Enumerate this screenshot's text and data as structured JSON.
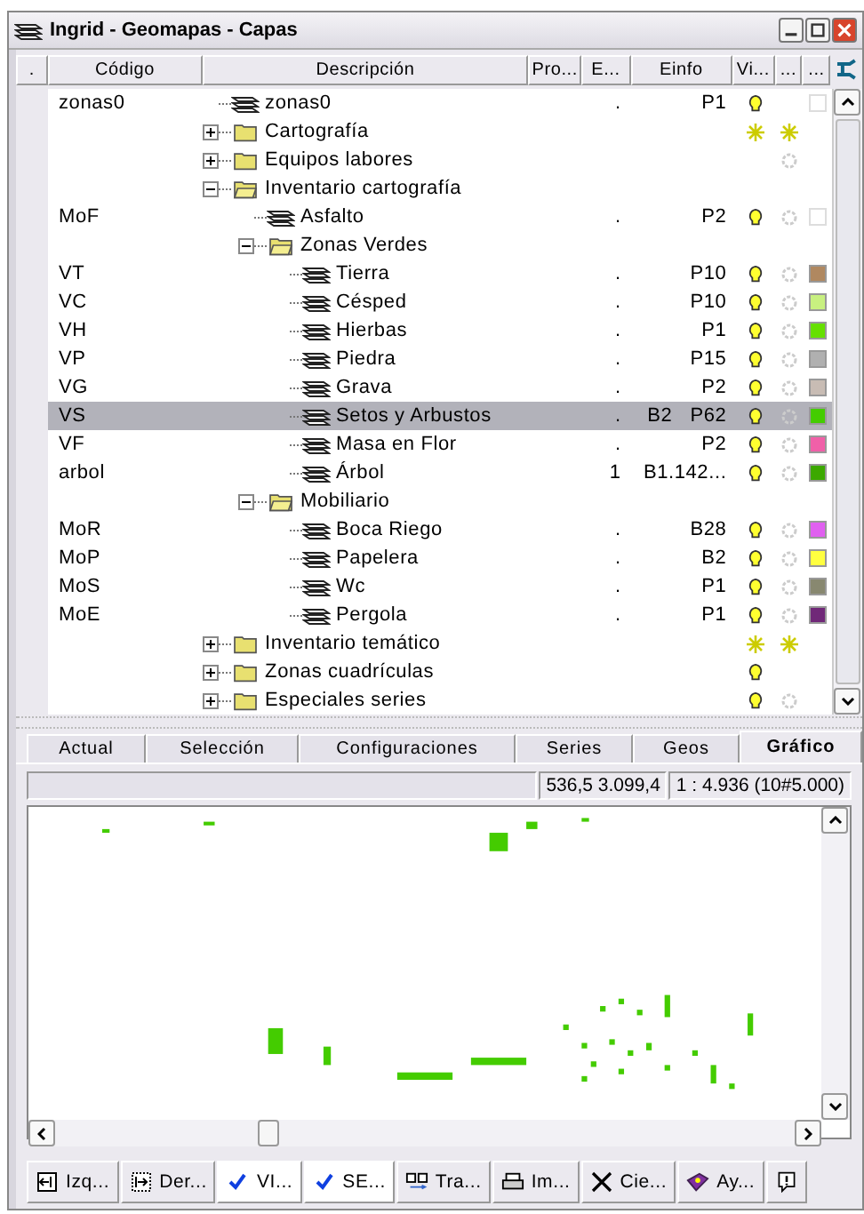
{
  "window": {
    "title": "Ingrid - Geomapas - Capas"
  },
  "table": {
    "columns": [
      ".",
      "Código",
      "Descripción",
      "Pro...",
      "E...",
      "Einfo",
      "Vi...",
      "...",
      "..."
    ],
    "rows": [
      {
        "kind": "layer",
        "code": "zonas0",
        "name": "zonas0",
        "mark": ".",
        "einfo": "P1",
        "visible": true,
        "partial": false,
        "ring": false,
        "checked": false,
        "selected": false
      },
      {
        "kind": "folder",
        "name": "Cartografía",
        "expanded": false,
        "visible": false,
        "partial": true,
        "ring": false,
        "selected": false
      },
      {
        "kind": "folder",
        "name": "Equipos labores",
        "expanded": false,
        "visible": false,
        "partial": false,
        "ring": true,
        "selected": false
      },
      {
        "kind": "folder",
        "name": "Inventario cartografía",
        "expanded": true,
        "visible": false,
        "partial": false,
        "ring": false,
        "selected": false,
        "children": [
          {
            "kind": "layer",
            "code": "MoF",
            "name": "Asfalto",
            "mark": ".",
            "einfo": "P2",
            "visible": true,
            "partial": false,
            "ring": true,
            "checked": false,
            "selected": false
          },
          {
            "kind": "folder",
            "name": "Zonas Verdes",
            "expanded": true,
            "visible": false,
            "partial": false,
            "ring": false,
            "selected": false,
            "children": [
              {
                "kind": "layer",
                "code": "VT",
                "name": "Tierra",
                "mark": ".",
                "einfo": "P10",
                "visible": true,
                "partial": false,
                "ring": true,
                "color": "#b08860",
                "selected": false
              },
              {
                "kind": "layer",
                "code": "VC",
                "name": "Césped",
                "mark": ".",
                "einfo": "P10",
                "visible": true,
                "partial": false,
                "ring": true,
                "color": "#c8f080",
                "selected": false
              },
              {
                "kind": "layer",
                "code": "VH",
                "name": "Hierbas",
                "mark": ".",
                "einfo": "P1",
                "visible": true,
                "partial": false,
                "ring": true,
                "color": "#66e000",
                "selected": false
              },
              {
                "kind": "layer",
                "code": "VP",
                "name": "Piedra",
                "mark": ".",
                "einfo": "P15",
                "visible": true,
                "partial": false,
                "ring": true,
                "color": "#b0b0b0",
                "selected": false
              },
              {
                "kind": "layer",
                "code": "VG",
                "name": "Grava",
                "mark": ".",
                "einfo": "P2",
                "visible": true,
                "partial": false,
                "ring": true,
                "color": "#c8bcb4",
                "selected": false
              },
              {
                "kind": "layer",
                "code": "VS",
                "name": "Setos y Arbustos",
                "mark": ".",
                "extra": "B2",
                "einfo": "P62",
                "visible": true,
                "partial": false,
                "ring": true,
                "color": "#44cc00",
                "selected": true
              },
              {
                "kind": "layer",
                "code": "VF",
                "name": "Masa en Flor",
                "mark": ".",
                "einfo": "P2",
                "visible": true,
                "partial": false,
                "ring": true,
                "color": "#f060a8",
                "selected": false
              },
              {
                "kind": "layer",
                "code": "arbol",
                "name": "Árbol",
                "mark": "1",
                "einfo": "B1.142...",
                "visible": true,
                "partial": false,
                "ring": true,
                "color": "#3ca800",
                "selected": false
              }
            ]
          },
          {
            "kind": "folder",
            "name": "Mobiliario",
            "expanded": true,
            "visible": false,
            "partial": false,
            "ring": false,
            "selected": false,
            "children": [
              {
                "kind": "layer",
                "code": "MoR",
                "name": "Boca Riego",
                "mark": ".",
                "einfo": "B28",
                "visible": true,
                "partial": false,
                "ring": true,
                "color": "#e060f0",
                "selected": false
              },
              {
                "kind": "layer",
                "code": "MoP",
                "name": "Papelera",
                "mark": ".",
                "einfo": "B2",
                "visible": true,
                "partial": false,
                "ring": true,
                "color": "#ffff40",
                "selected": false
              },
              {
                "kind": "layer",
                "code": "MoS",
                "name": "Wc",
                "mark": ".",
                "einfo": "P1",
                "visible": true,
                "partial": false,
                "ring": true,
                "color": "#888870",
                "selected": false
              },
              {
                "kind": "layer",
                "code": "MoE",
                "name": "Pergola",
                "mark": ".",
                "einfo": "P1",
                "visible": true,
                "partial": false,
                "ring": true,
                "color": "#702878",
                "selected": false
              }
            ]
          }
        ]
      },
      {
        "kind": "folder",
        "name": "Inventario temático",
        "expanded": false,
        "visible": false,
        "partial": true,
        "ring": false,
        "selected": false
      },
      {
        "kind": "folder",
        "name": "Zonas cuadrículas",
        "expanded": false,
        "visible": true,
        "partial": false,
        "ring": false,
        "selected": false
      },
      {
        "kind": "folder",
        "name": "Especiales series",
        "expanded": false,
        "visible": true,
        "partial": false,
        "ring": true,
        "selected": false
      }
    ]
  },
  "tabs": [
    {
      "label": "Actual",
      "selected": false
    },
    {
      "label": "Selección",
      "selected": false
    },
    {
      "label": "Configuraciones",
      "selected": false
    },
    {
      "label": "Series",
      "selected": false
    },
    {
      "label": "Geos",
      "selected": false
    },
    {
      "label": "Gráfico",
      "selected": true
    }
  ],
  "status": {
    "coords": "536,5  3.099,4",
    "scale": "1 : 4.936 (10#5.000)"
  },
  "toolbar": [
    {
      "kind": "left",
      "label": "Izq..."
    },
    {
      "kind": "right",
      "label": "Der..."
    },
    {
      "kind": "check",
      "label": "VI...",
      "checked": true
    },
    {
      "kind": "check",
      "label": "SE...",
      "checked": true
    },
    {
      "kind": "translate",
      "label": "Tra..."
    },
    {
      "kind": "print",
      "label": "Im..."
    },
    {
      "kind": "close",
      "label": "Cie..."
    },
    {
      "kind": "help",
      "label": "Ay..."
    },
    {
      "kind": "note"
    }
  ]
}
